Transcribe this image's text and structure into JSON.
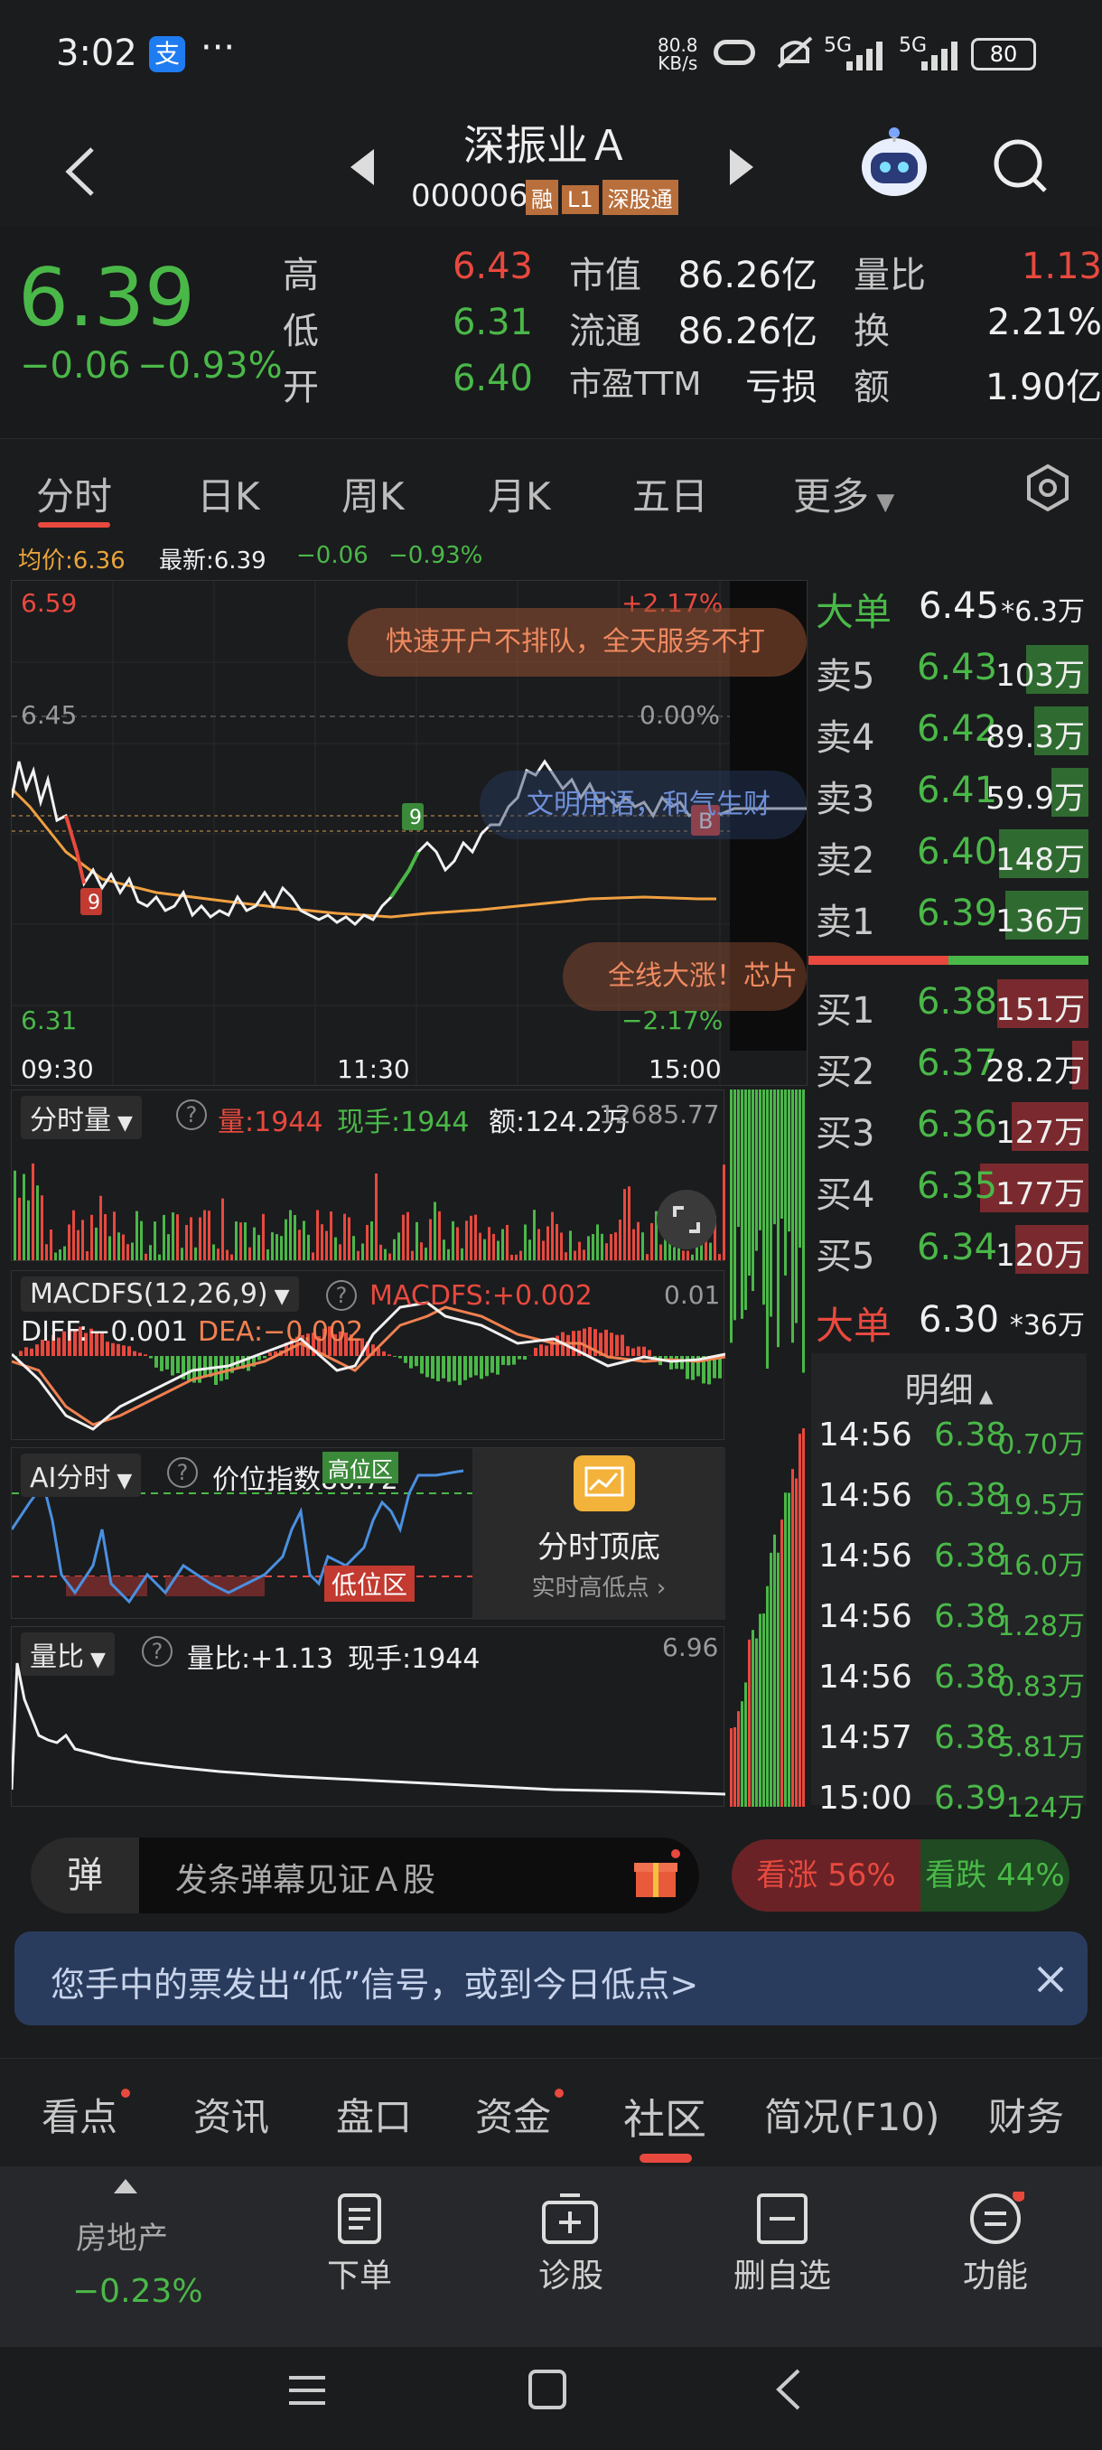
{
  "status": {
    "time": "3:02",
    "speed_top": "80.8",
    "speed_bottom": "KB/s",
    "signal1": "5G",
    "signal2": "5G",
    "battery": "80"
  },
  "header": {
    "stock_name": "深振业Ａ",
    "stock_code": "000006",
    "badges": [
      "融",
      "L1",
      "深股通"
    ]
  },
  "quote": {
    "price": "6.39",
    "change": "−0.06",
    "change_pct": "−0.93%",
    "stats": [
      {
        "label": "高",
        "value": "6.43"
      },
      {
        "label": "低",
        "value": "6.31"
      },
      {
        "label": "开",
        "value": "6.40"
      }
    ],
    "stats2": [
      {
        "label": "市值",
        "value": "86.26亿"
      },
      {
        "label": "流通",
        "value": "86.26亿"
      },
      {
        "label": "市盈TTM",
        "value": "亏损"
      }
    ],
    "stats3": [
      {
        "label": "量比",
        "value": "1.13"
      },
      {
        "label": "换",
        "value": "2.21%"
      },
      {
        "label": "额",
        "value": "1.90亿"
      }
    ]
  },
  "tabs": [
    "分时",
    "日K",
    "周K",
    "月K",
    "五日",
    "更多"
  ],
  "chart_info": {
    "avg_label": "均价:6.36",
    "latest_label": "最新:6.39",
    "change": "−0.06",
    "change_pct": "−0.93%",
    "top_price": "6.59",
    "top_pct": "+2.17%",
    "mid_price": "6.45",
    "mid_pct": "0.00%",
    "bottom_price": "6.31",
    "bottom_pct": "−2.17%",
    "time_start": "09:30",
    "time_mid": "11:30",
    "time_end": "15:00",
    "marker_b": "B",
    "marker_9a": "9",
    "marker_9b": "9",
    "ad1": "快速开户不排队，全天服务不打",
    "ad2": "文明用语，和气生财",
    "ad3": "全线大涨！芯片"
  },
  "volume_panel": {
    "title": "分时量",
    "vol": "量:1944",
    "hand": "现手:1944",
    "amount": "额:124.2万",
    "max": "12685.77"
  },
  "macd_panel": {
    "title": "MACDFS(12,26,9)",
    "macdfs": "MACDFS:+0.002",
    "diff": "DIFF:−0.001",
    "dea": "DEA:−0.002",
    "max": "0.01"
  },
  "ai_panel": {
    "title": "AI分时",
    "index": "价位指数86.72",
    "high_tag": "高位区",
    "low_tag": "低位区",
    "promo_title": "分时顶底",
    "promo_sub": "实时高低点 ›"
  },
  "ratio_panel": {
    "title": "量比",
    "ratio": "量比:+1.13",
    "hand": "现手:1944",
    "max": "6.96"
  },
  "orderbook": {
    "big_sell": {
      "label": "大单",
      "price": "6.45",
      "vol": "*6.3万"
    },
    "asks": [
      {
        "label": "卖5",
        "price": "6.43",
        "vol": "103万",
        "w": 0.3
      },
      {
        "label": "卖4",
        "price": "6.42",
        "vol": "89.3万",
        "w": 0.26
      },
      {
        "label": "卖3",
        "price": "6.41",
        "vol": "59.9万",
        "w": 0.18
      },
      {
        "label": "卖2",
        "price": "6.40",
        "vol": "148万",
        "w": 0.43
      },
      {
        "label": "卖1",
        "price": "6.39",
        "vol": "136万",
        "w": 0.4
      }
    ],
    "bids": [
      {
        "label": "买1",
        "price": "6.38",
        "vol": "151万",
        "w": 0.44
      },
      {
        "label": "买2",
        "price": "6.37",
        "vol": "28.2万",
        "w": 0.08
      },
      {
        "label": "买3",
        "price": "6.36",
        "vol": "127万",
        "w": 0.37
      },
      {
        "label": "买4",
        "price": "6.35",
        "vol": "177万",
        "w": 0.52
      },
      {
        "label": "买5",
        "price": "6.34",
        "vol": "120万",
        "w": 0.35
      }
    ],
    "big_buy": {
      "label": "大单",
      "price": "6.30",
      "vol": "*36万"
    }
  },
  "details": {
    "title": "明细",
    "rows": [
      {
        "time": "14:56",
        "price": "6.38",
        "vol": "0.70万"
      },
      {
        "time": "14:56",
        "price": "6.38",
        "vol": "19.5万"
      },
      {
        "time": "14:56",
        "price": "6.38",
        "vol": "16.0万"
      },
      {
        "time": "14:56",
        "price": "6.38",
        "vol": "1.28万"
      },
      {
        "time": "14:56",
        "price": "6.38",
        "vol": "0.83万"
      },
      {
        "time": "14:57",
        "price": "6.38",
        "vol": "5.81万"
      },
      {
        "time": "15:00",
        "price": "6.39",
        "vol": "124万"
      }
    ]
  },
  "danmu": {
    "badge": "弹",
    "placeholder": "发条弹幕见证Ａ股",
    "up": "看涨 56%",
    "down": "看跌 44%",
    "up_pct": 56
  },
  "notice": {
    "text": "您手中的票发出“低”信号，或到今日低点>"
  },
  "bottom_tabs": [
    "看点",
    "资讯",
    "盘口",
    "资金",
    "社区",
    "简况(F10)",
    "财务"
  ],
  "bottom_nav": {
    "sector": "房地产",
    "sector_change": "−0.23%",
    "items": [
      "下单",
      "诊股",
      "删自选",
      "功能"
    ]
  }
}
